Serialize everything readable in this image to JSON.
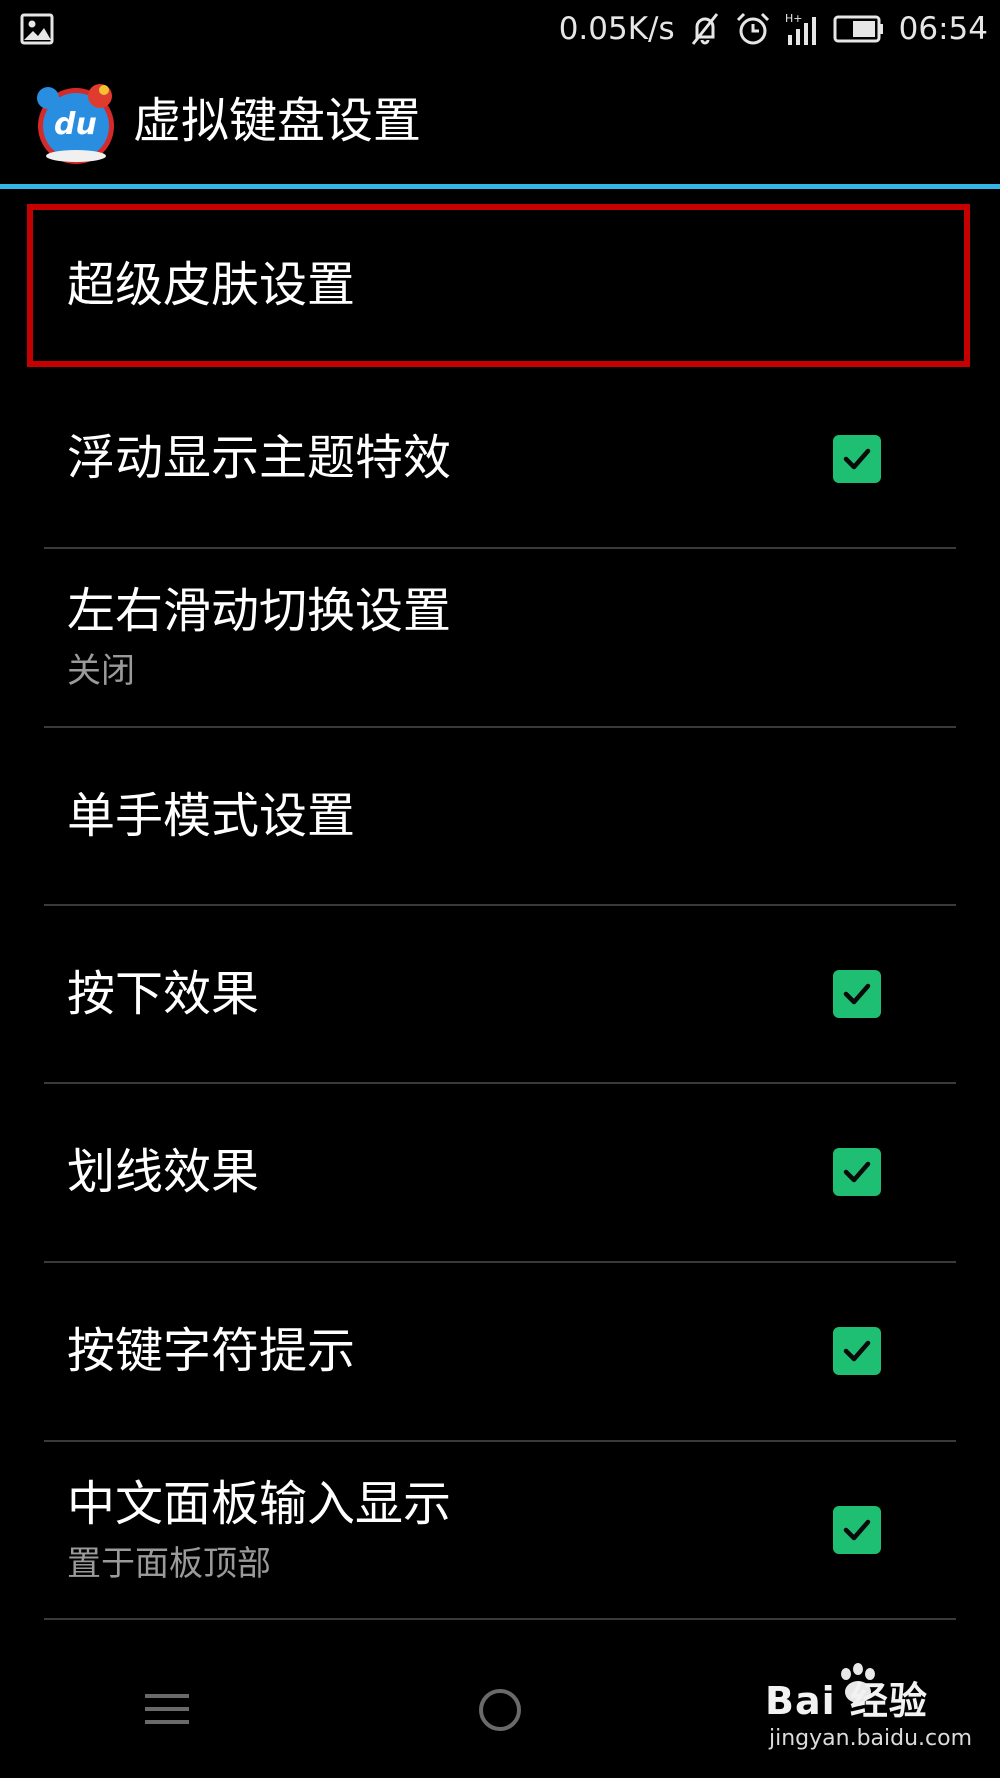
{
  "status_bar": {
    "network_speed": "0.05K/s",
    "time": "06:54",
    "icons": [
      "image-icon",
      "mute-icon",
      "alarm-icon",
      "signal-icon",
      "battery-icon"
    ]
  },
  "action_bar": {
    "title": "虚拟键盘设置",
    "logo_icon": "baidu-du-logo"
  },
  "colors": {
    "accent_line": "#33b5e5",
    "checkbox_fill": "#1fbf73",
    "highlight_border": "#c40000"
  },
  "settings": [
    {
      "title": "超级皮肤设置",
      "summary": "",
      "checked": null,
      "highlighted": true
    },
    {
      "title": "浮动显示主题特效",
      "summary": "",
      "checked": true
    },
    {
      "title": "左右滑动切换设置",
      "summary": "关闭",
      "checked": null
    },
    {
      "title": "单手模式设置",
      "summary": "",
      "checked": null
    },
    {
      "title": "按下效果",
      "summary": "",
      "checked": true
    },
    {
      "title": "划线效果",
      "summary": "",
      "checked": true
    },
    {
      "title": "按键字符提示",
      "summary": "",
      "checked": true
    },
    {
      "title": "中文面板输入显示",
      "summary": "置于面板顶部",
      "checked": true
    }
  ],
  "nav_bar": {
    "buttons": [
      "menu-icon",
      "home-icon"
    ]
  },
  "watermark": {
    "brand": "Bai 经验",
    "domain": "jingyan.baidu.com"
  }
}
